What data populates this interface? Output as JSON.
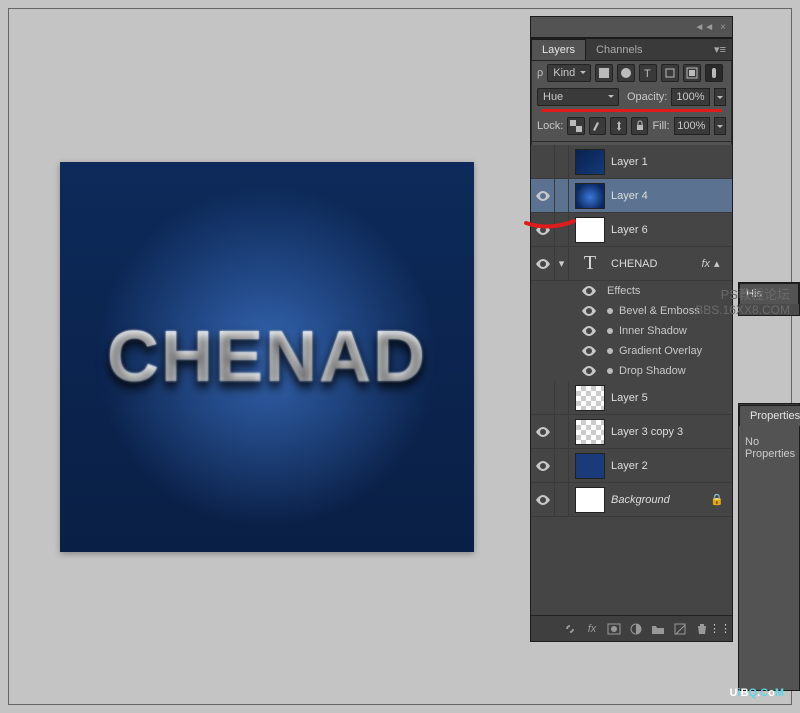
{
  "collapse": {
    "arrows": "◄◄",
    "close": "×"
  },
  "tabs": {
    "layers": "Layers",
    "channels": "Channels"
  },
  "filter": {
    "kind_label": "Kind"
  },
  "blend": {
    "mode": "Hue",
    "opacity_label": "Opacity:",
    "opacity_value": "100%"
  },
  "lock": {
    "label": "Lock:",
    "fill_label": "Fill:",
    "fill_value": "100%"
  },
  "layers": [
    {
      "name": "Layer 1"
    },
    {
      "name": "Layer 4"
    },
    {
      "name": "Layer 6"
    },
    {
      "name": "CHENAD"
    },
    {
      "name": "Layer 5"
    },
    {
      "name": "Layer 3 copy 3"
    },
    {
      "name": "Layer 2"
    },
    {
      "name": "Background"
    }
  ],
  "effects": {
    "header": "Effects",
    "items": [
      "Bevel & Emboss",
      "Inner Shadow",
      "Gradient Overlay",
      "Drop Shadow"
    ]
  },
  "fx_label": "fx",
  "canvas_text": "CHENAD",
  "properties": {
    "tab": "Properties",
    "body": "No Properties"
  },
  "history": {
    "tab": "His"
  },
  "watermark": {
    "line1": "PS教程论坛",
    "line2": "BBS.16XX8.COM"
  },
  "brand": {
    "u": "U",
    "i": "i",
    "b": "B",
    "q": "Q",
    "dot": ".",
    "c": "C",
    "o": "o",
    "m": "M"
  }
}
